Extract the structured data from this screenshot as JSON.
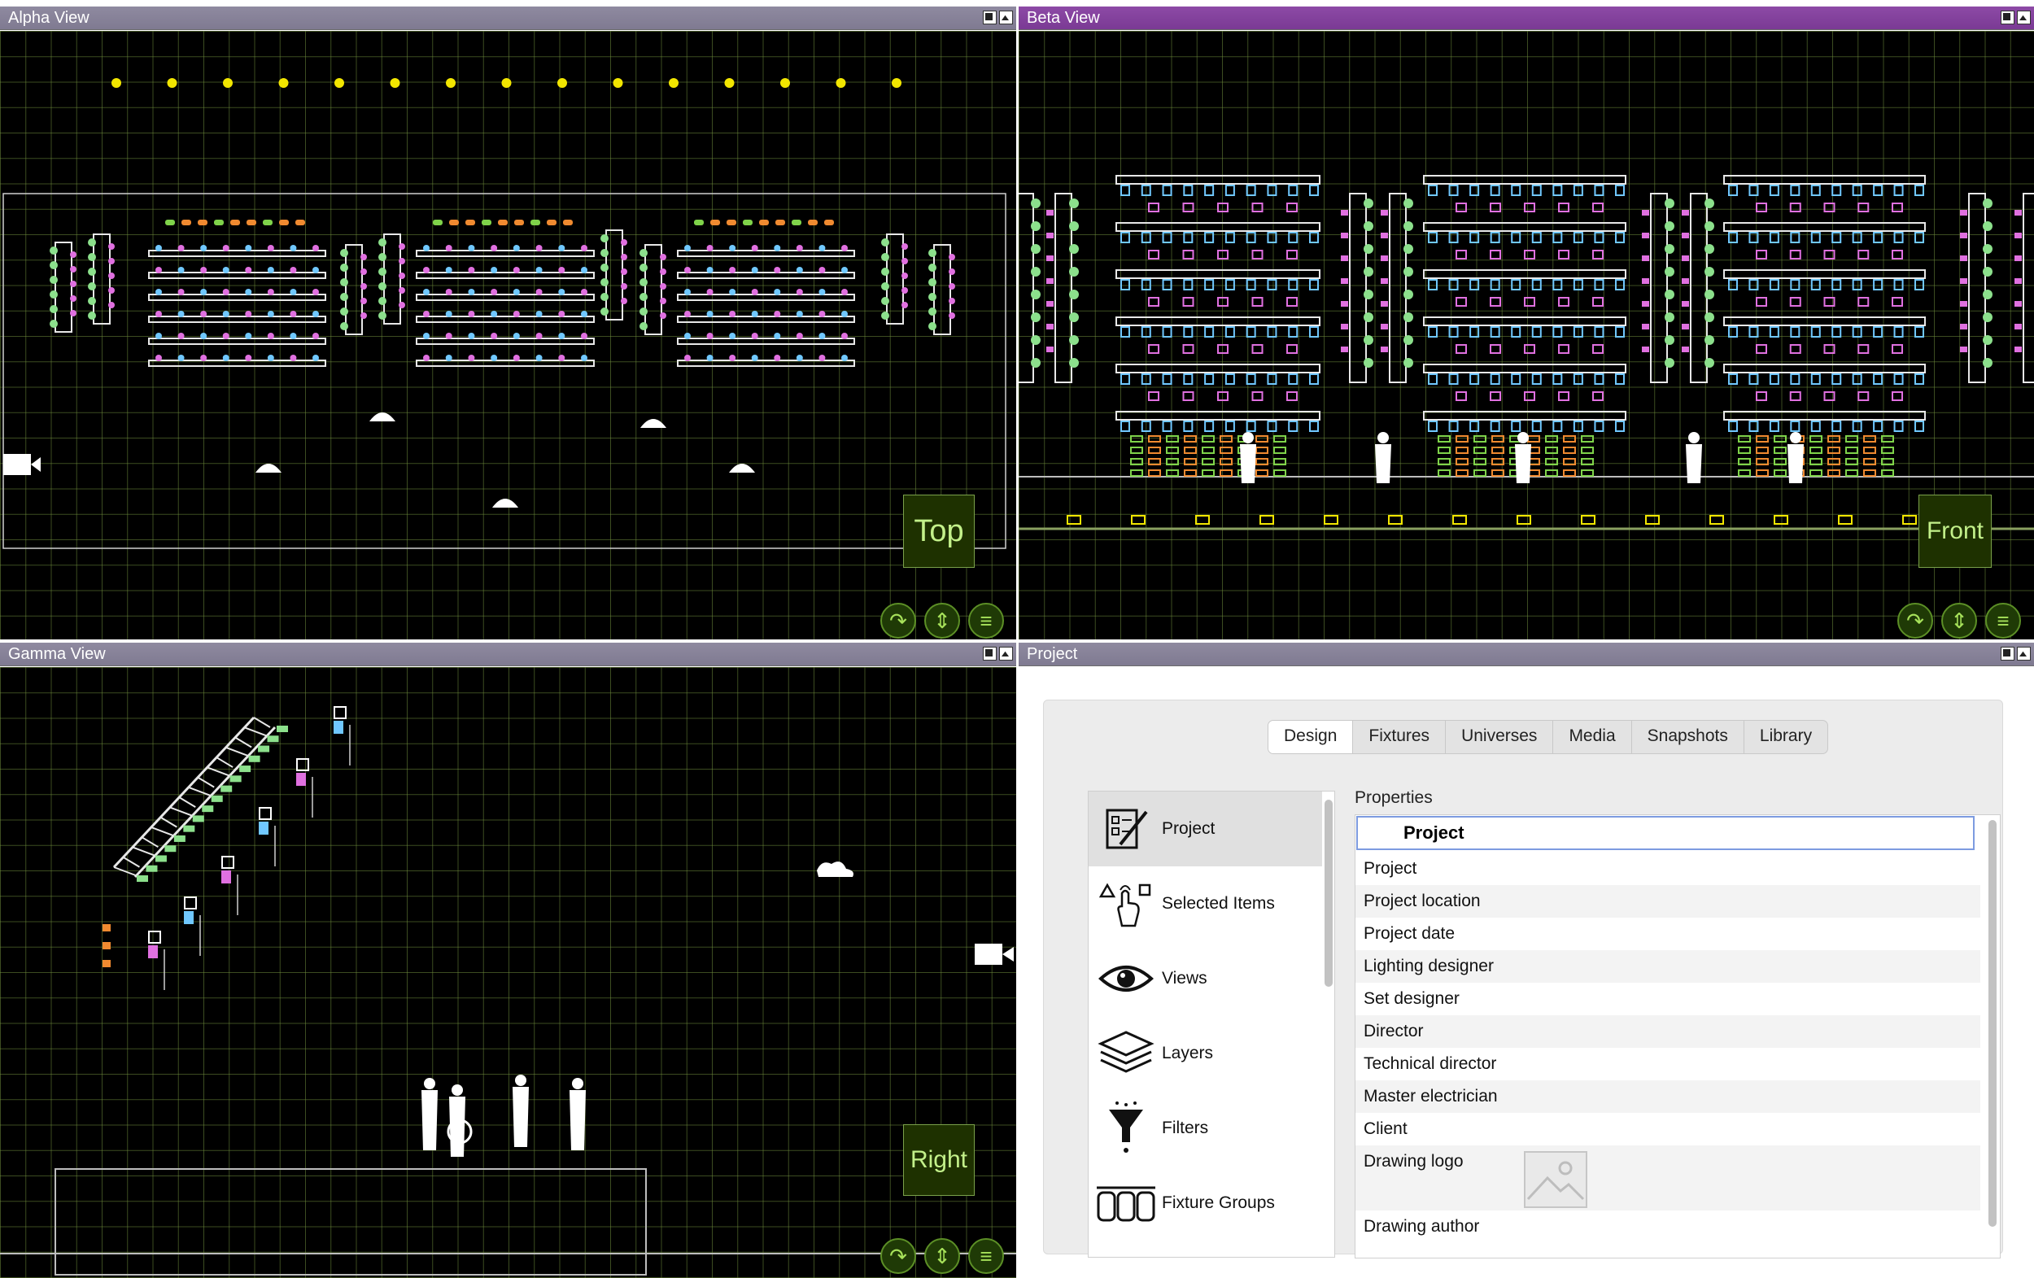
{
  "panes": {
    "alpha": {
      "title": "Alpha View",
      "view_label": "Top"
    },
    "beta": {
      "title": "Beta View",
      "view_label": "Front"
    },
    "gamma": {
      "title": "Gamma View",
      "view_label": "Right"
    },
    "project": {
      "title": "Project"
    }
  },
  "view_buttons": [
    "rotate-icon",
    "zoom-fit-icon",
    "menu-icon"
  ],
  "project_panel": {
    "tabs": [
      {
        "label": "Design",
        "active": true
      },
      {
        "label": "Fixtures"
      },
      {
        "label": "Universes"
      },
      {
        "label": "Media"
      },
      {
        "label": "Snapshots"
      },
      {
        "label": "Library"
      }
    ],
    "sidebar": [
      {
        "label": "Project",
        "icon": "project-form-icon",
        "selected": true
      },
      {
        "label": "Selected Items",
        "icon": "selection-hand-icon"
      },
      {
        "label": "Views",
        "icon": "eye-icon"
      },
      {
        "label": "Layers",
        "icon": "layers-icon"
      },
      {
        "label": "Filters",
        "icon": "funnel-icon"
      },
      {
        "label": "Fixture Groups",
        "icon": "fixture-groups-icon"
      }
    ],
    "properties_title": "Properties",
    "properties_header": "Project",
    "properties": [
      "Project",
      "Project location",
      "Project date",
      "Lighting designer",
      "Set designer",
      "Director",
      "Technical director",
      "Master electrician",
      "Client",
      "Drawing logo",
      "Drawing author"
    ]
  },
  "colors": {
    "titlebar_gray": "#8a86a0",
    "titlebar_active": "#8545a0",
    "canvas_bg": "#000000",
    "grid": "#5f7a2e",
    "view_label_text": "#c3f08a",
    "fixture_green": "#8ce08c",
    "fixture_pink": "#e070e0",
    "fixture_yellow": "#f2e600",
    "fixture_orange": "#f08a30"
  }
}
